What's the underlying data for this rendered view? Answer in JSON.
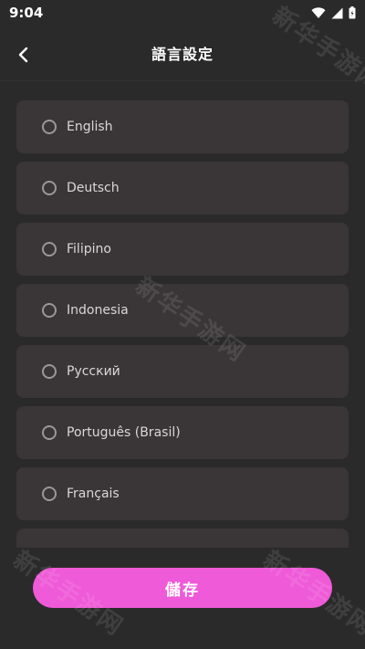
{
  "status_bar": {
    "time": "9:04"
  },
  "header": {
    "title": "語言設定"
  },
  "languages": [
    "English",
    "Deutsch",
    "Filipino",
    "Indonesia",
    "Русский",
    "Português (Brasil)",
    "Français"
  ],
  "footer": {
    "save_label": "儲存"
  },
  "watermark": "新华手游网",
  "colors": {
    "background": "#2b2a2b",
    "card": "#3a3537",
    "accent": "#ef5ad8",
    "text": "#dcd6d9"
  }
}
